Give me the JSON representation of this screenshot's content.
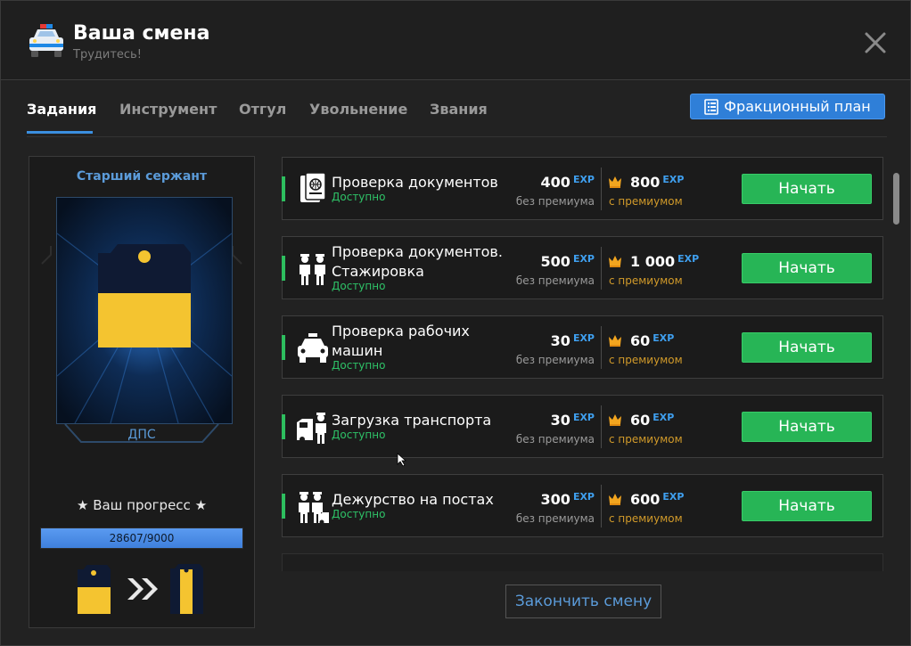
{
  "header": {
    "title": "Ваша смена",
    "subtitle": "Трудитесь!",
    "icon": "police-car-icon"
  },
  "tabs": [
    {
      "label": "Задания",
      "active": true
    },
    {
      "label": "Инструмент",
      "active": false
    },
    {
      "label": "Отгул",
      "active": false
    },
    {
      "label": "Увольнение",
      "active": false
    },
    {
      "label": "Звания",
      "active": false
    }
  ],
  "plan_button": {
    "label": "Фракционный план",
    "icon": "document-list-icon"
  },
  "rank": {
    "name": "Старший сержант",
    "department": "ДПС",
    "progress_title": "Ваш прогресс",
    "progress_text": "28607/9000",
    "progress_fraction": 1.0
  },
  "common": {
    "exp_tag": "EXP",
    "no_premium": "без премиума",
    "with_premium": "с премиумом",
    "start_label": "Начать"
  },
  "tasks": [
    {
      "line1": "Проверка документов",
      "line2": "",
      "status": "Доступно",
      "exp": "400",
      "exp_premium": "800",
      "icon": "passport-icon"
    },
    {
      "line1": "Проверка документов.",
      "line2": "Стажировка",
      "status": "Доступно",
      "exp": "500",
      "exp_premium": "1 000",
      "icon": "officers-icon"
    },
    {
      "line1": "Проверка рабочих",
      "line2": "машин",
      "status": "Доступно",
      "exp": "30",
      "exp_premium": "60",
      "icon": "police-car-icon"
    },
    {
      "line1": "Загрузка транспорта",
      "line2": "",
      "status": "Доступно",
      "exp": "30",
      "exp_premium": "60",
      "icon": "tow-officer-icon"
    },
    {
      "line1": "Дежурство на постах",
      "line2": "",
      "status": "Доступно",
      "exp": "300",
      "exp_premium": "600",
      "icon": "post-duty-icon"
    }
  ],
  "end_shift": {
    "label": "Закончить смену"
  },
  "colors": {
    "accent_blue": "#3b8fe0",
    "start_green": "#27b556",
    "status_green": "#2ec267",
    "premium_gold": "#d19a2a",
    "insignia_yellow": "#f4c430",
    "insignia_navy": "#0f1a33"
  }
}
